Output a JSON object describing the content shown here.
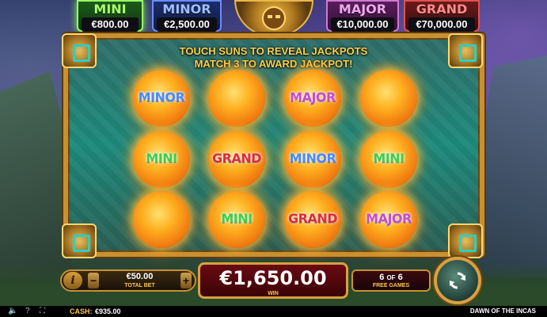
{
  "jackpots": {
    "mini": {
      "name": "MINI",
      "value": "€800.00"
    },
    "minor": {
      "name": "MINOR",
      "value": "€2,500.00"
    },
    "major": {
      "name": "MAJOR",
      "value": "€10,000.00"
    },
    "grand": {
      "name": "GRAND",
      "value": "€70,000.00"
    }
  },
  "board": {
    "instruction_line1": "TOUCH SUNS TO REVEAL JACKPOTS",
    "instruction_line2": "MATCH 3 TO AWARD JACKPOT!",
    "suns": [
      [
        "MINOR",
        "",
        "MAJOR",
        ""
      ],
      [
        "MINI",
        "GRAND",
        "MINOR",
        "MINI"
      ],
      [
        "",
        "MINI",
        "GRAND",
        "MAJOR"
      ]
    ]
  },
  "controls": {
    "info_label": "i",
    "minus_label": "−",
    "plus_label": "+",
    "total_bet_value": "€50.00",
    "total_bet_caption": "TOTAL BET",
    "win_value": "€1,650.00",
    "win_caption": "WIN",
    "free_games_current": "6",
    "free_games_of": "OF",
    "free_games_total": "6",
    "free_games_caption": "FREE GAMES"
  },
  "status_bar": {
    "cash_label": "CASH:",
    "cash_value": "€935.00",
    "game_title": "DAWN OF THE INCAS"
  },
  "icons": {
    "volume": "speaker-icon",
    "help": "question-icon",
    "fullscreen": "fullscreen-icon",
    "spin": "spin-arrows-icon"
  }
}
